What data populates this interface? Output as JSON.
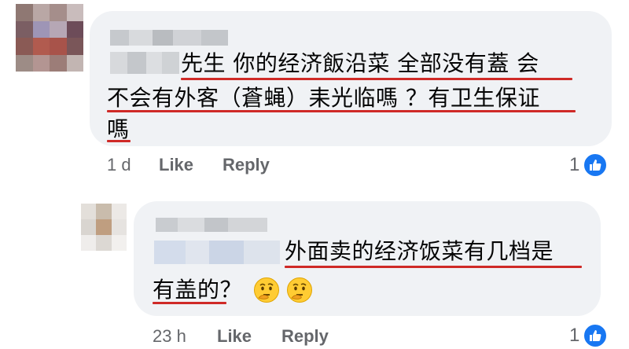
{
  "comments": [
    {
      "text_lines": [
        "先生 你的经济飯沿菜 全部没有蓋 会",
        "不会有外客（蒼蝇）耒光临嗎 ？有卫生保证",
        "嗎"
      ],
      "time": "1 d",
      "like_label": "Like",
      "reply_label": "Reply",
      "reaction_count": "1",
      "reaction_icon": "like-thumb-icon"
    },
    {
      "text_lines": [
        "外面卖的经济饭菜有几档是",
        "有盖的？"
      ],
      "emojis": [
        "thinking-face-icon",
        "thinking-face-icon"
      ],
      "time": "23 h",
      "like_label": "Like",
      "reply_label": "Reply",
      "reaction_count": "1",
      "reaction_icon": "like-thumb-icon"
    }
  ],
  "colors": {
    "bubble": "#f0f2f5",
    "underline": "#cf2a27",
    "meta_text": "#65676b",
    "like_blue": "#1877f2"
  }
}
